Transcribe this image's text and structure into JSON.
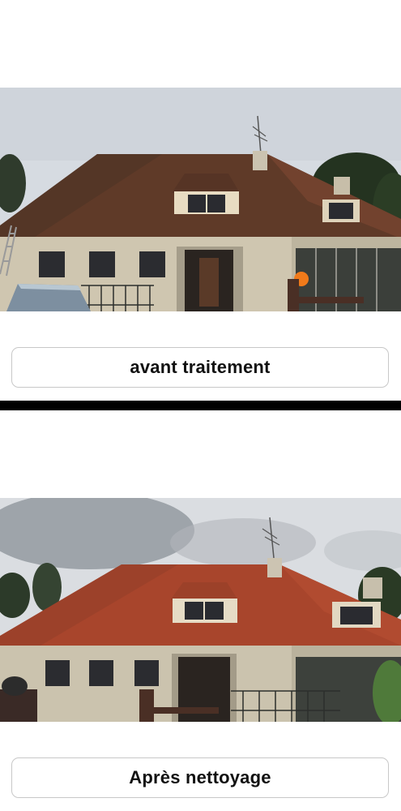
{
  "before": {
    "caption": "avant traitement",
    "roof_color": "#6b3f2a",
    "sky_color": "#d7dbe0"
  },
  "after": {
    "caption": "Après nettoyage",
    "roof_color": "#a8442c",
    "sky_color": "#dfe1e4"
  },
  "divider_color": "#000000"
}
